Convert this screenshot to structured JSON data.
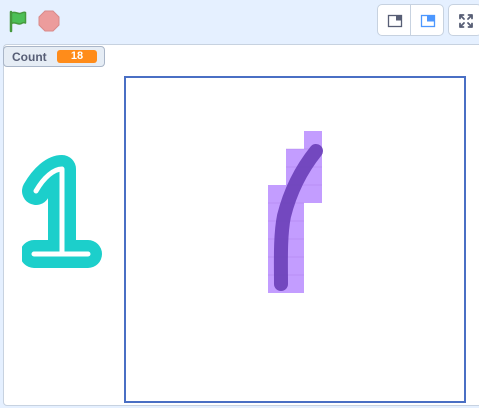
{
  "toolbar": {
    "green_flag_icon": "green-flag-icon",
    "stop_icon": "stop-sign-icon",
    "small_stage_icon": "small-stage-icon",
    "large_stage_icon": "large-stage-icon",
    "fullscreen_icon": "fullscreen-icon"
  },
  "monitor": {
    "label": "Count",
    "value": "18"
  },
  "sprite": {
    "digit": "1",
    "color": "#1ccfcb"
  },
  "canvas": {
    "stroke_color": "#6a3fb8",
    "cell_color": "#b98dff",
    "border_color": "#4a6fc4"
  }
}
